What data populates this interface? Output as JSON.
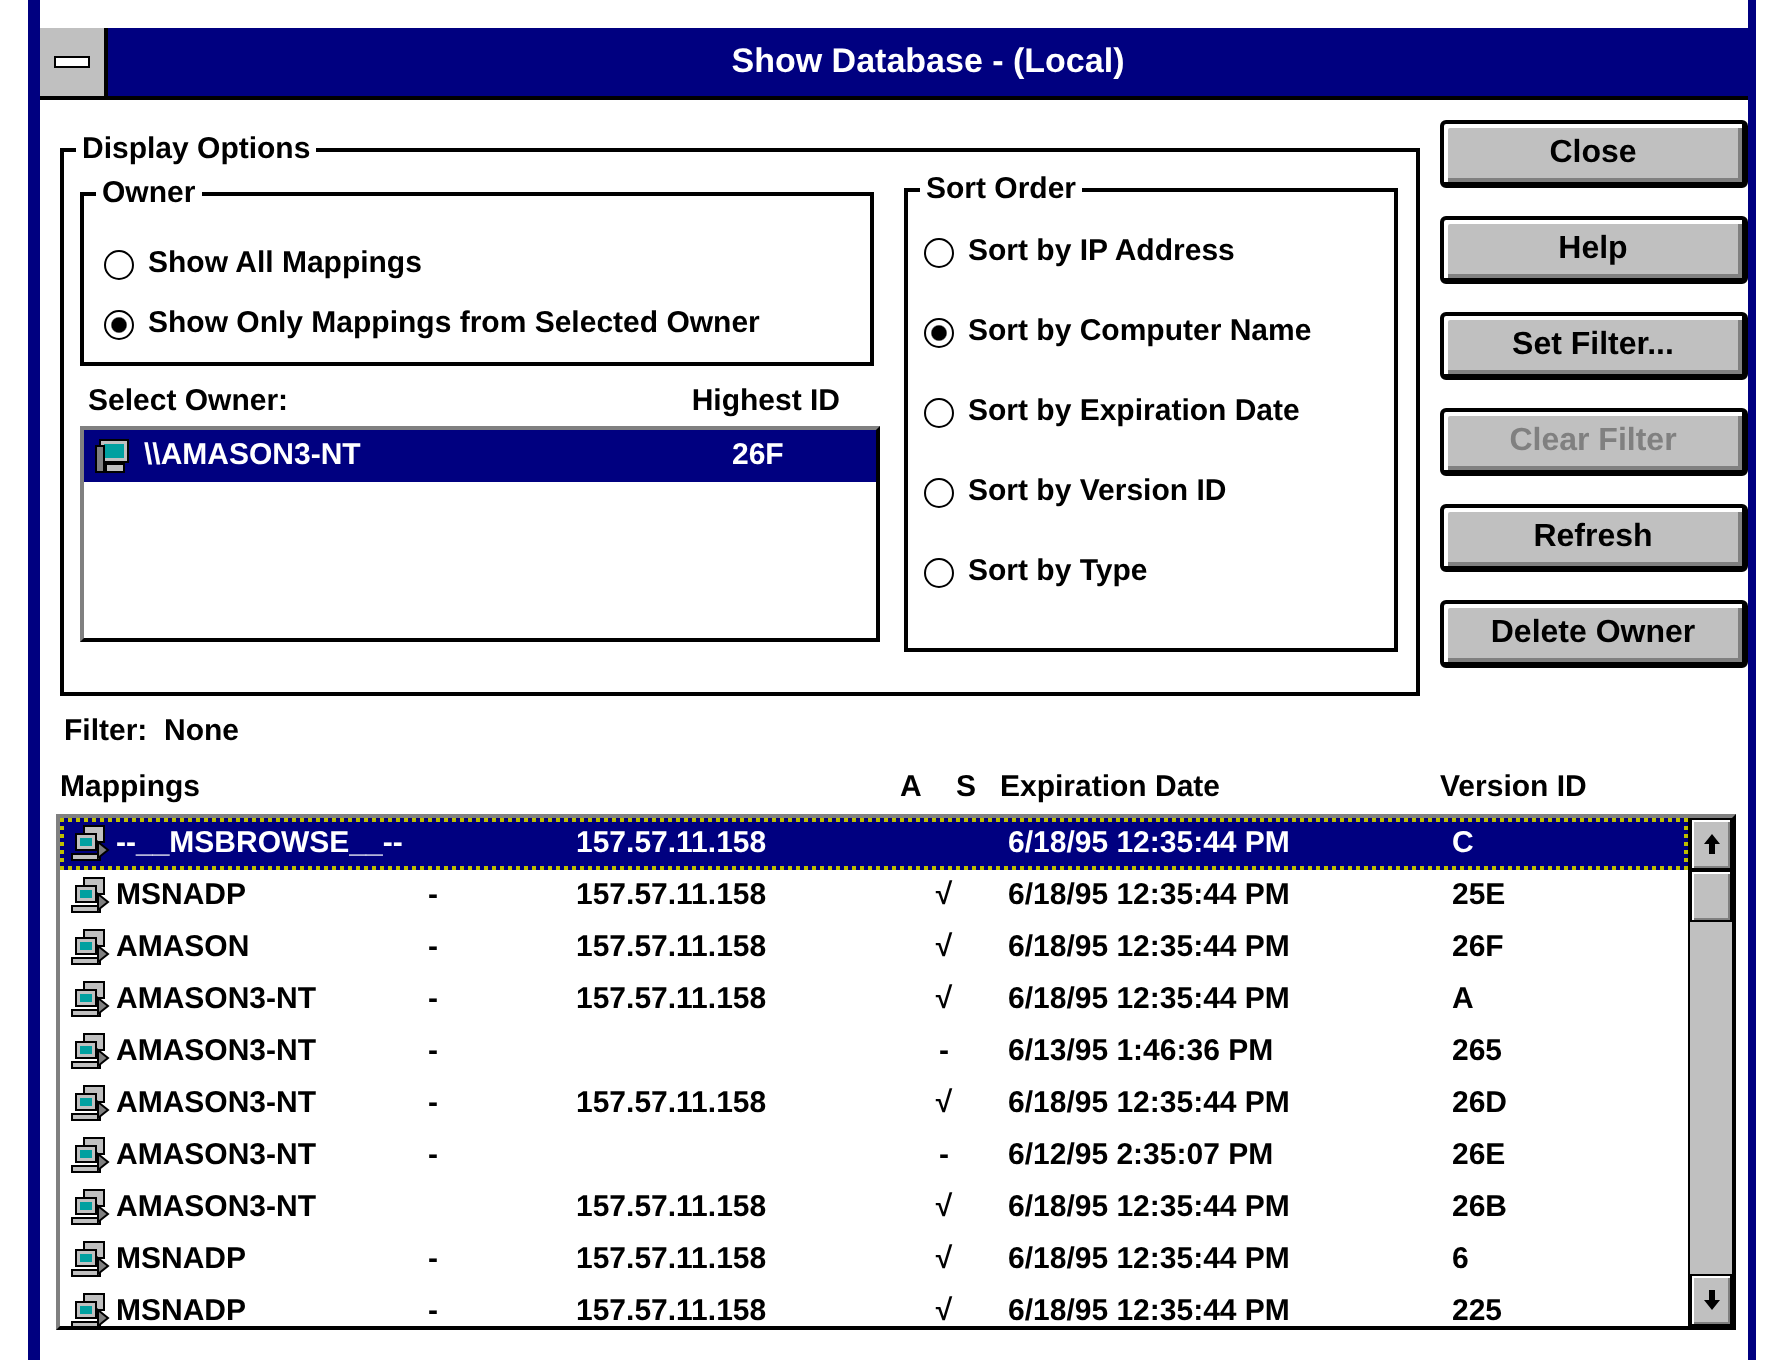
{
  "window": {
    "title": "Show Database - (Local)"
  },
  "display_options": {
    "title": "Display Options",
    "owner_group": {
      "title": "Owner",
      "options": [
        {
          "label": "Show All Mappings",
          "selected": false
        },
        {
          "label": "Show Only Mappings from Selected Owner",
          "selected": true
        }
      ]
    },
    "owner_list": {
      "label": "Select Owner:",
      "id_label": "Highest ID",
      "items": [
        {
          "name": "\\\\AMASON3-NT",
          "highest_id": "26F",
          "selected": true
        }
      ]
    },
    "sort_order": {
      "title": "Sort Order",
      "options": [
        {
          "label": "Sort by IP Address",
          "selected": false
        },
        {
          "label": "Sort by Computer Name",
          "selected": true
        },
        {
          "label": "Sort by Expiration Date",
          "selected": false
        },
        {
          "label": "Sort by Version ID",
          "selected": false
        },
        {
          "label": "Sort by Type",
          "selected": false
        }
      ]
    }
  },
  "buttons": [
    {
      "label": "Close",
      "disabled": false
    },
    {
      "label": "Help",
      "disabled": false
    },
    {
      "label": "Set Filter...",
      "disabled": false
    },
    {
      "label": "Clear Filter",
      "disabled": true
    },
    {
      "label": "Refresh",
      "disabled": false
    },
    {
      "label": "Delete Owner",
      "disabled": false
    }
  ],
  "filter": {
    "label": "Filter:",
    "value": "None"
  },
  "mappings": {
    "columns": [
      "Mappings",
      "A",
      "S",
      "Expiration Date",
      "Version ID"
    ],
    "rows": [
      {
        "name": "--__MSBROWSE__--",
        "type": "",
        "ip": "157.57.11.158",
        "active": "",
        "expiration": "6/18/95 12:35:44 PM",
        "version": "C",
        "selected": true
      },
      {
        "name": "MSNADP",
        "type": "-",
        "ip": "157.57.11.158",
        "active": "√",
        "expiration": "6/18/95 12:35:44 PM",
        "version": "25E",
        "selected": false
      },
      {
        "name": "AMASON",
        "type": "-",
        "ip": "157.57.11.158",
        "active": "√",
        "expiration": "6/18/95 12:35:44 PM",
        "version": "26F",
        "selected": false
      },
      {
        "name": "AMASON3-NT",
        "type": "-",
        "ip": "157.57.11.158",
        "active": "√",
        "expiration": "6/18/95 12:35:44 PM",
        "version": "A",
        "selected": false
      },
      {
        "name": "AMASON3-NT",
        "type": "-",
        "ip": "",
        "active": "-",
        "expiration": "6/13/95 1:46:36 PM",
        "version": "265",
        "selected": false
      },
      {
        "name": "AMASON3-NT",
        "type": "-",
        "ip": "157.57.11.158",
        "active": "√",
        "expiration": "6/18/95 12:35:44 PM",
        "version": "26D",
        "selected": false
      },
      {
        "name": "AMASON3-NT",
        "type": "-",
        "ip": "",
        "active": "-",
        "expiration": "6/12/95 2:35:07 PM",
        "version": "26E",
        "selected": false
      },
      {
        "name": "AMASON3-NT",
        "type": "",
        "ip": "157.57.11.158",
        "active": "√",
        "expiration": "6/18/95 12:35:44 PM",
        "version": "26B",
        "selected": false
      },
      {
        "name": "MSNADP",
        "type": "-",
        "ip": "157.57.11.158",
        "active": "√",
        "expiration": "6/18/95 12:35:44 PM",
        "version": "6",
        "selected": false
      },
      {
        "name": "MSNADP",
        "type": "-",
        "ip": "157.57.11.158",
        "active": "√",
        "expiration": "6/18/95 12:35:44 PM",
        "version": "225",
        "selected": false
      }
    ]
  }
}
